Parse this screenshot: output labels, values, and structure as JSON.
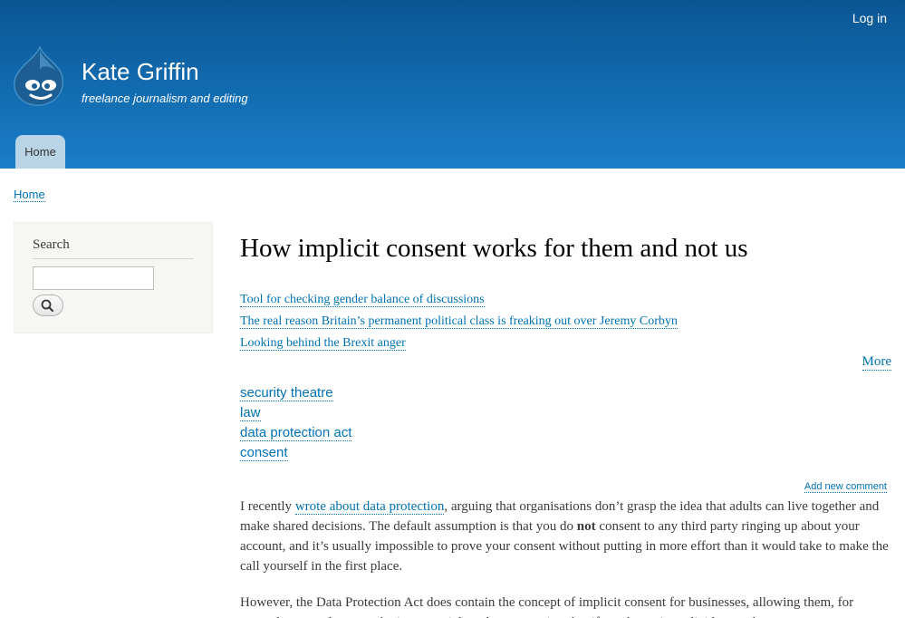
{
  "header": {
    "login_label": "Log in",
    "site_name": "Kate Griffin",
    "slogan": "freelance journalism and editing",
    "nav_home": "Home",
    "logo_icon": "drupal-drop-icon",
    "bg_top": "#0a5693",
    "bg_bottom": "#1a7ec8"
  },
  "breadcrumb": {
    "home": "Home"
  },
  "sidebar": {
    "search_title": "Search",
    "search_value": "",
    "search_icon": "search-icon"
  },
  "article": {
    "title": "How implicit consent works for them and not us",
    "related": [
      "Tool for checking gender balance of discussions",
      "The real reason Britain’s permanent political class is freaking out over Jeremy Corbyn",
      "Looking behind the Brexit anger"
    ],
    "more_label": "More",
    "tags": [
      "security theatre",
      "law",
      "data protection act",
      "consent"
    ],
    "add_comment_label": "Add new comment",
    "para1": {
      "before_link": "I recently ",
      "link": "wrote about data protection",
      "after_link": ", arguing that organisations don’t grasp the idea that adults can live together and make shared decisions. The default assumption is that you do ",
      "bold": "not",
      "after_bold": " consent to any third party ringing up about your account, and it’s usually impossible to prove your consent without putting in more effort than it would take to make the call yourself in the first place."
    },
    "para2": "However, the Data Protection Act does contain the concept of implicit consent for businesses, allowing them, for example, to send you marketing material on the assumption that if you haven’t explicitly opted out you"
  },
  "colors": {
    "link": "#0071b3",
    "tab_bg": "#b9d3e7",
    "sidebar_bg": "#f6f6f2"
  }
}
